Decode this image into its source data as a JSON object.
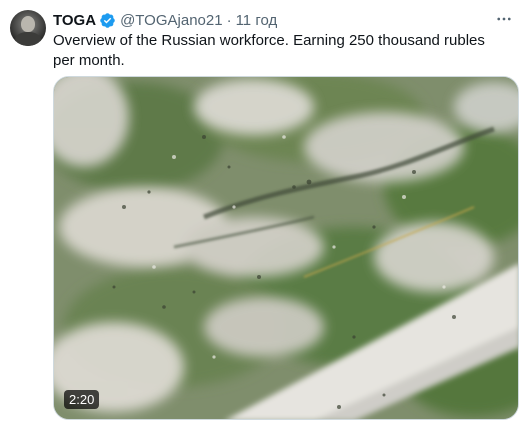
{
  "tweet": {
    "author_name": "TOGA",
    "handle": "@TOGAjano21",
    "separator": "·",
    "time": "11 год",
    "text": "Overview of the Russian workforce. Earning 250 thousand rubles per month.",
    "verified": true,
    "media": {
      "type": "video",
      "duration": "2:20"
    },
    "colors": {
      "verified_blue": "#1d9bf0",
      "text": "#0f1419",
      "muted": "#536471"
    },
    "icons": {
      "avatar": "avatar",
      "verified": "verified-badge-icon",
      "more": "more-options-icon"
    }
  }
}
